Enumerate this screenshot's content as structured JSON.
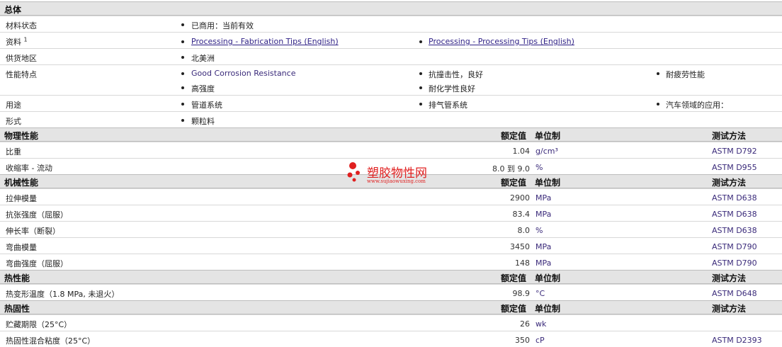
{
  "overview": {
    "title": "总体",
    "material_status_label": "材料状态",
    "material_status_value": "已商用：当前有效",
    "docs_label": "资料",
    "docs_sup": "1",
    "docs_links": [
      "Processing - Fabrication Tips (English)",
      "Processing - Processing Tips (English)"
    ],
    "region_label": "供货地区",
    "region_value": "北美洲",
    "features_label": "性能特点",
    "features": [
      "Good Corrosion Resistance",
      "抗撞击性，良好",
      "耐疲劳性能",
      "高强度",
      "耐化学性良好"
    ],
    "uses_label": "用途",
    "uses": [
      "管道系统",
      "排气管系统",
      "汽车领域的应用："
    ],
    "form_label": "形式",
    "form_value": "颗粒料"
  },
  "headers": {
    "nominal": "额定值",
    "unit": "单位制",
    "method": "测试方法"
  },
  "physical": {
    "title": "物理性能",
    "rows": [
      {
        "label": "比重",
        "value": "1.04",
        "unit": "g/cm³",
        "method": "ASTM D792"
      },
      {
        "label": "收缩率 - 流动",
        "value": "8.0 到 9.0",
        "unit": "%",
        "method": "ASTM D955"
      }
    ]
  },
  "mechanical": {
    "title": "机械性能",
    "rows": [
      {
        "label": "拉伸模量",
        "value": "2900",
        "unit": "MPa",
        "method": "ASTM D638"
      },
      {
        "label": "抗张强度（屈服）",
        "value": "83.4",
        "unit": "MPa",
        "method": "ASTM D638"
      },
      {
        "label": "伸长率（断裂）",
        "value": "8.0",
        "unit": "%",
        "method": "ASTM D638"
      },
      {
        "label": "弯曲模量",
        "value": "3450",
        "unit": "MPa",
        "method": "ASTM D790"
      },
      {
        "label": "弯曲强度（屈服）",
        "value": "148",
        "unit": "MPa",
        "method": "ASTM D790"
      }
    ]
  },
  "thermal": {
    "title": "热性能",
    "rows": [
      {
        "label": "热变形温度（1.8 MPa, 未退火）",
        "value": "98.9",
        "unit": "°C",
        "method": "ASTM D648"
      }
    ]
  },
  "thermoset": {
    "title": "热固性",
    "rows": [
      {
        "label": "贮藏期限（25°C）",
        "value": "26",
        "unit": "wk",
        "method": ""
      },
      {
        "label": "热固性混合粘度（25°C）",
        "value": "350",
        "unit": "cP",
        "method": "ASTM D2393"
      }
    ]
  },
  "watermark": {
    "name": "塑胶物性网",
    "url": "www.sujiaowuxing.com",
    "color": "#e02020"
  }
}
